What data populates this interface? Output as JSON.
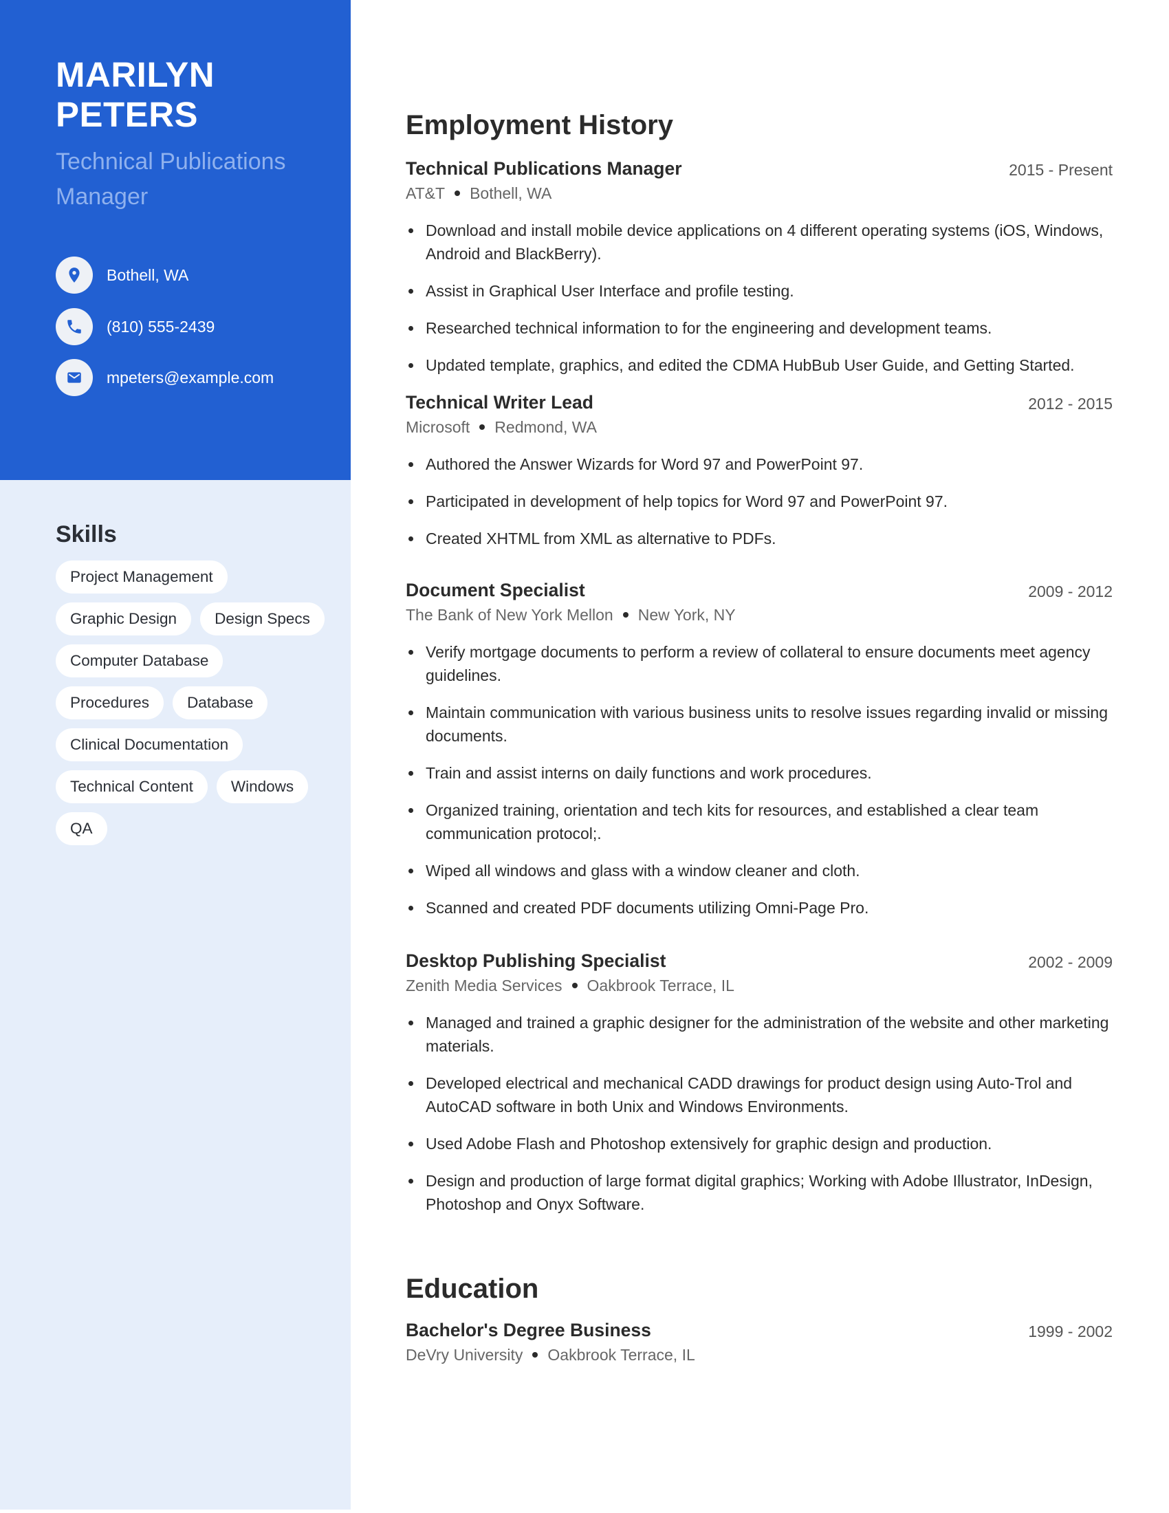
{
  "profile": {
    "name_line1": "MARILYN",
    "name_line2": "PETERS",
    "headline": "Technical Publications Manager"
  },
  "contact": {
    "location": {
      "icon": "location-pin-icon",
      "text": "Bothell, WA"
    },
    "phone": {
      "icon": "phone-icon",
      "text": "(810) 555-2439"
    },
    "email": {
      "icon": "envelope-icon",
      "text": "mpeters@example.com"
    }
  },
  "skills": {
    "title": "Skills",
    "items": [
      "Project Management",
      "Graphic Design",
      "Design Specs",
      "Computer Database",
      "Procedures",
      "Database",
      "Clinical Documentation",
      "Technical Content",
      "Windows",
      "QA"
    ]
  },
  "employment": {
    "title": "Employment History",
    "jobs": [
      {
        "title": "Technical Publications Manager",
        "dates": "2015 - Present",
        "company": "AT&T",
        "location": "Bothell, WA",
        "bullets": [
          "Download and install mobile device applications on 4 different operating systems (iOS, Windows, Android and BlackBerry).",
          "Assist in Graphical User Interface and profile testing.",
          "Researched technical information to for the engineering and development teams.",
          "Updated template, graphics, and edited the CDMA HubBub User Guide, and Getting Started."
        ]
      },
      {
        "title": "Technical Writer Lead",
        "dates": "2012 - 2015",
        "company": "Microsoft",
        "location": "Redmond, WA",
        "bullets": [
          "Authored the Answer Wizards for Word 97 and PowerPoint 97.",
          "Participated in development of help topics for Word 97 and PowerPoint 97.",
          "Created XHTML from XML as alternative to PDFs."
        ]
      },
      {
        "title": "Document Specialist",
        "dates": "2009 - 2012",
        "company": "The Bank of New York Mellon",
        "location": "New York, NY",
        "bullets": [
          "Verify mortgage documents to perform a review of collateral to ensure documents meet agency guidelines.",
          "Maintain communication with various business units to resolve issues regarding invalid or missing documents.",
          "Train and assist interns on daily functions and work procedures.",
          "Organized training, orientation and tech kits for resources, and established a clear team communication protocol;.",
          "Wiped all windows and glass with a window cleaner and cloth.",
          "Scanned and created PDF documents utilizing Omni-Page Pro."
        ]
      },
      {
        "title": "Desktop Publishing Specialist",
        "dates": "2002 - 2009",
        "company": "Zenith Media Services",
        "location": "Oakbrook Terrace, IL",
        "bullets": [
          "Managed and trained a graphic designer for the administration of the website and other marketing materials.",
          "Developed electrical and mechanical CADD drawings for product design using Auto-Trol and AutoCAD software in both Unix and Windows Environments.",
          "Used Adobe Flash and Photoshop extensively for graphic design and production.",
          "Design and production of large format digital graphics; Working with Adobe Illustrator, InDesign, Photoshop and Onyx Software."
        ]
      }
    ]
  },
  "education": {
    "title": "Education",
    "entries": [
      {
        "degree": "Bachelor's Degree Business",
        "dates": "1999 - 2002",
        "school": "DeVry University",
        "location": "Oakbrook Terrace, IL"
      }
    ]
  },
  "colors": {
    "accent": "#2260d2",
    "sidebar_bg": "#e6eefa",
    "headline": "#8fb1ee"
  }
}
